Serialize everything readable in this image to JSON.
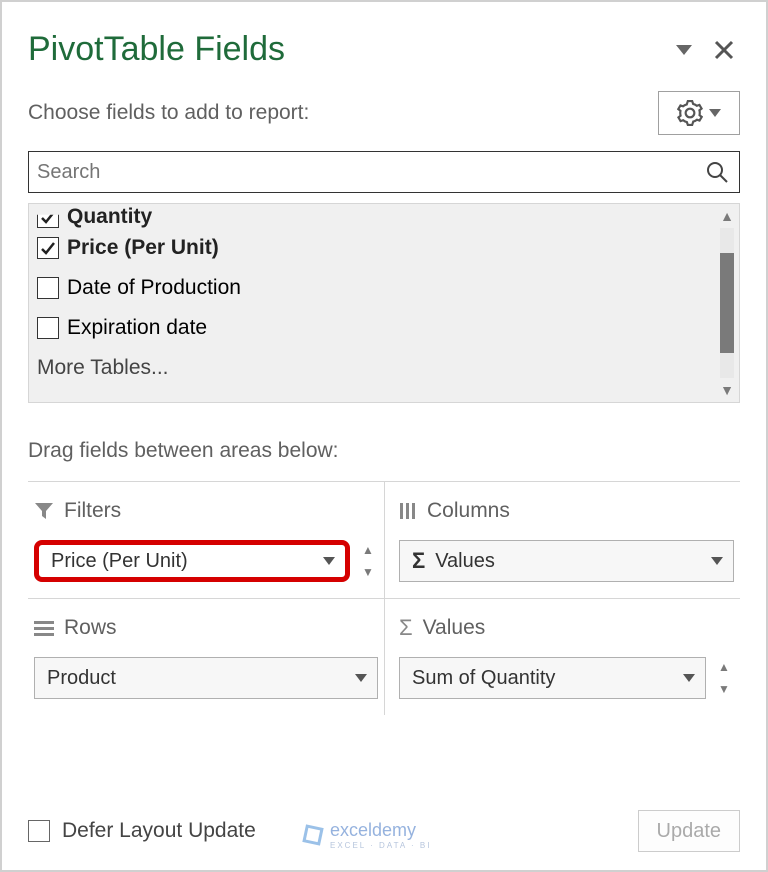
{
  "header": {
    "title": "PivotTable Fields"
  },
  "subtitle": "Choose fields to add to report:",
  "search": {
    "placeholder": "Search"
  },
  "fields": [
    {
      "label": "Quantity",
      "checked": true,
      "bold": true,
      "cut": true
    },
    {
      "label": "Price (Per Unit)",
      "checked": true,
      "bold": true,
      "cut": false
    },
    {
      "label": "Date of Production",
      "checked": false,
      "bold": false,
      "cut": false
    },
    {
      "label": "Expiration date",
      "checked": false,
      "bold": false,
      "cut": false
    }
  ],
  "more_tables": "More Tables...",
  "drag_label": "Drag fields between areas below:",
  "areas": {
    "filters": {
      "title": "Filters",
      "chip": "Price (Per Unit)"
    },
    "columns": {
      "title": "Columns",
      "chip": "Values"
    },
    "rows": {
      "title": "Rows",
      "chip": "Product"
    },
    "values": {
      "title": "Values",
      "chip": "Sum of Quantity"
    }
  },
  "footer": {
    "defer_label": "Defer Layout Update",
    "update_label": "Update"
  },
  "watermark": {
    "main": "exceldemy",
    "sub": "EXCEL · DATA · BI"
  }
}
